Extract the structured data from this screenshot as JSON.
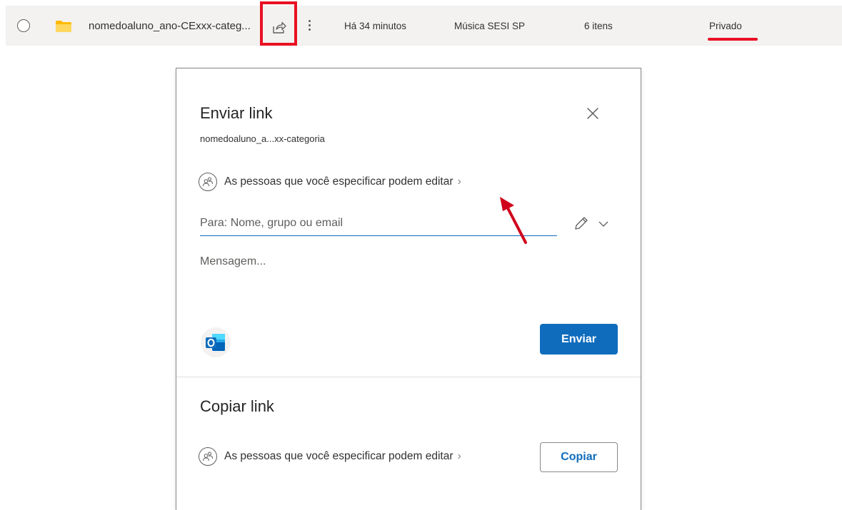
{
  "file_row": {
    "name": "nomedoaluno_ano-CExxx-categ...",
    "modified": "Há 34 minutos",
    "owner": "Música SESI SP",
    "item_count": "6 itens",
    "access": "Privado"
  },
  "dialog": {
    "send": {
      "title": "Enviar link",
      "subtitle": "nomedoaluno_a...xx-categoria",
      "permission": "As pessoas que você especificar podem editar",
      "to_placeholder": "Para: Nome, grupo ou email",
      "message_placeholder": "Mensagem...",
      "send_button": "Enviar"
    },
    "copy": {
      "title": "Copiar link",
      "permission": "As pessoas que você especificar podem editar",
      "copy_button": "Copiar"
    }
  },
  "icons": {
    "folder": "folder-icon",
    "share": "share-icon",
    "more": "more-vertical-icon",
    "close": "close-icon",
    "people": "people-icon",
    "pencil": "pencil-icon",
    "outlook": "outlook-icon"
  },
  "colors": {
    "accent": "#0f6cbd",
    "highlight_red": "#e81123",
    "row_background": "#f3f2f1",
    "folder_yellow": "#ffc83d"
  }
}
